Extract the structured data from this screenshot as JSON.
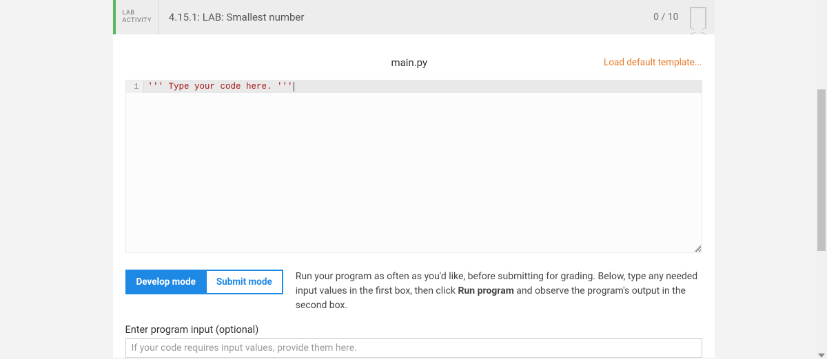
{
  "header": {
    "activity_line1": "LAB",
    "activity_line2": "ACTIVITY",
    "title": "4.15.1: LAB: Smallest number",
    "score": "0 / 10"
  },
  "editor": {
    "filename": "main.py",
    "load_template": "Load default template...",
    "line_number": "1",
    "code": "''' Type your code here. '''"
  },
  "modes": {
    "develop": "Develop mode",
    "submit": "Submit mode",
    "description_before": "Run your program as often as you'd like, before submitting for grading. Below, type any needed input values in the first box, then click ",
    "description_bold": "Run program",
    "description_after": " and observe the program's output in the second box."
  },
  "input": {
    "label": "Enter program input (optional)",
    "placeholder": "If your code requires input values, provide them here."
  }
}
